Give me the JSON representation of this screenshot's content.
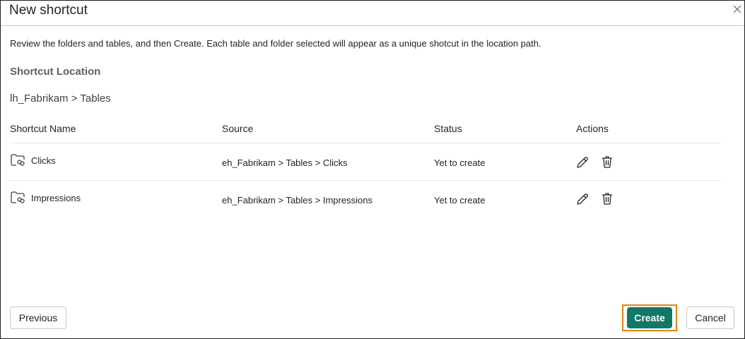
{
  "dialog": {
    "title": "New shortcut",
    "description": "Review the folders and tables, and then Create. Each table and folder selected will appear as a unique shotcut in the location path.",
    "location_label": "Shortcut Location",
    "location_path": "lh_Fabrikam > Tables"
  },
  "table": {
    "headers": {
      "name": "Shortcut Name",
      "source": "Source",
      "status": "Status",
      "actions": "Actions"
    },
    "rows": [
      {
        "name": "Clicks",
        "source": "eh_Fabrikam > Tables > Clicks",
        "status": "Yet to create"
      },
      {
        "name": "Impressions",
        "source": "eh_Fabrikam > Tables > Impressions",
        "status": "Yet to create"
      }
    ]
  },
  "footer": {
    "previous_label": "Previous",
    "create_label": "Create",
    "cancel_label": "Cancel"
  },
  "colors": {
    "primary": "#117865",
    "highlight": "#e8840a"
  },
  "icons": {
    "close": "close-icon",
    "folder_shortcut": "folder-link-icon",
    "edit": "pencil-icon",
    "delete": "trash-icon"
  }
}
